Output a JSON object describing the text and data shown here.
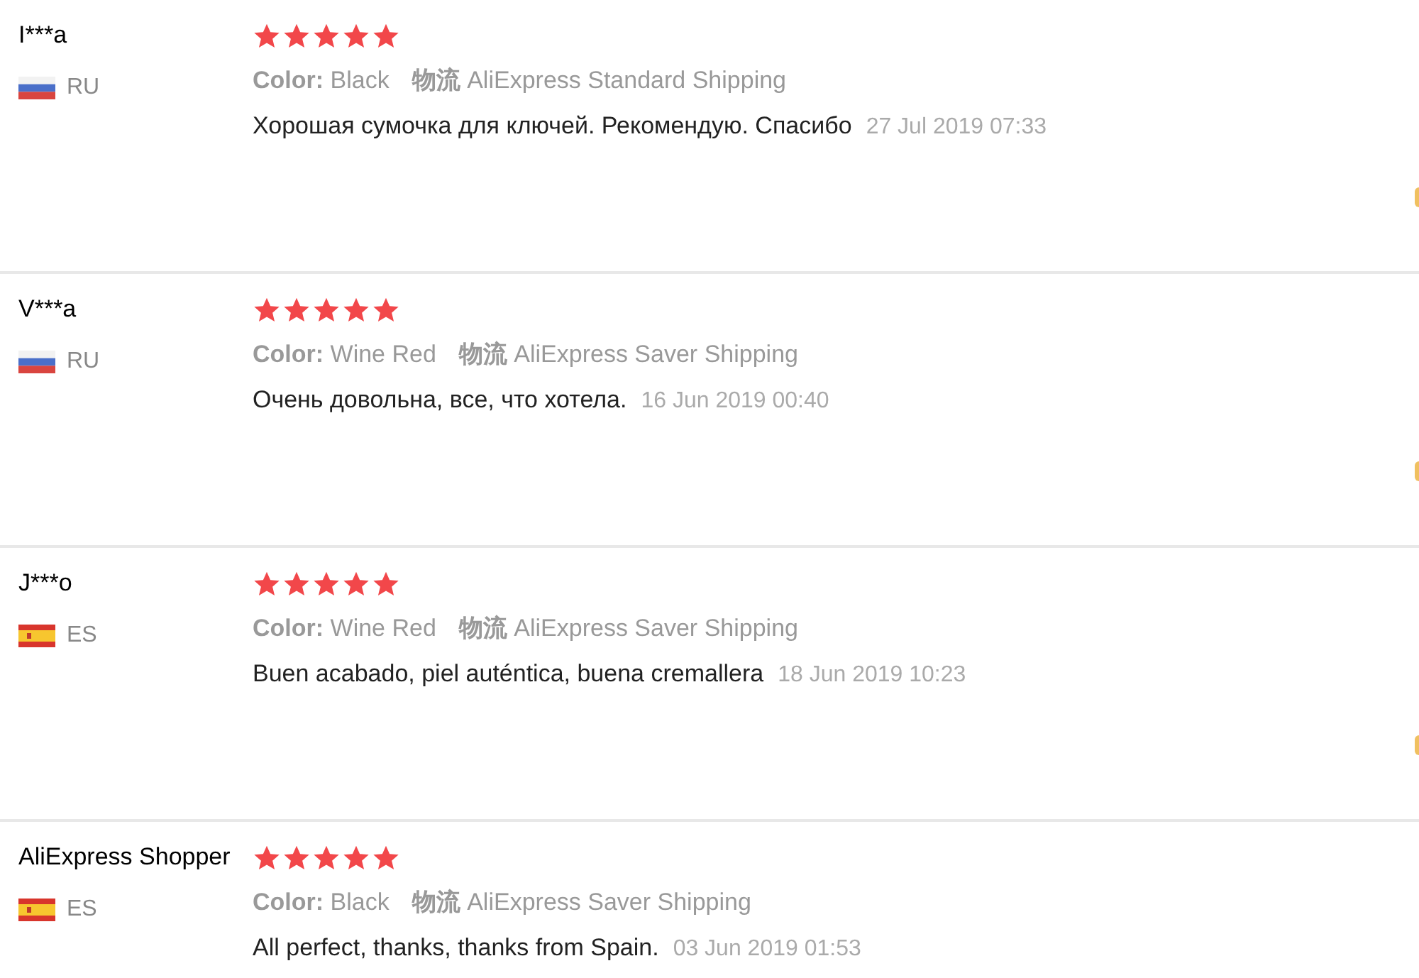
{
  "reviews": [
    {
      "name": "I***a",
      "kind": "ru",
      "country": "RU",
      "stars": 5,
      "color_label": "Color:",
      "color_value": "Black",
      "shipping_label": "物流",
      "shipping_value": "AliExpress Standard Shipping",
      "text": "Хорошая сумочка для ключей. Рекомендую. Спасибо",
      "date": "27 Jul 2019 07:33"
    },
    {
      "name": "V***a",
      "kind": "ru",
      "country": "RU",
      "stars": 5,
      "color_label": "Color:",
      "color_value": "Wine Red",
      "shipping_label": "物流",
      "shipping_value": "AliExpress Saver Shipping",
      "text": "Очень довольна, все, что хотела.",
      "date": "16 Jun 2019 00:40"
    },
    {
      "name": "J***o",
      "kind": "es",
      "country": "ES",
      "stars": 5,
      "color_label": "Color:",
      "color_value": "Wine Red",
      "shipping_label": "物流",
      "shipping_value": "AliExpress Saver Shipping",
      "text": "Buen acabado, piel auténtica, buena cremallera",
      "date": "18 Jun 2019 10:23"
    },
    {
      "name": "AliExpress Shopper",
      "kind": "es",
      "country": "ES",
      "stars": 5,
      "color_label": "Color:",
      "color_value": "Black",
      "shipping_label": "物流",
      "shipping_value": "AliExpress Saver Shipping",
      "text": "All perfect, thanks, thanks from Spain.",
      "date": "03 Jun 2019 01:53"
    }
  ]
}
